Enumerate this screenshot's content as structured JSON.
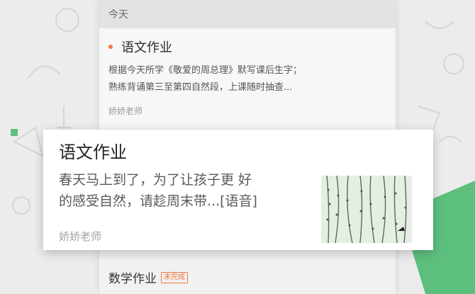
{
  "section": {
    "date_label": "今天"
  },
  "homework_card": {
    "dot_color": "#f07a3a",
    "title": "语文作业",
    "body": "根据今天所学《敬爱的周总理》默写课后生字；\n熟练背诵第三至第四自然段，上课随时抽查...",
    "teacher": "娇娇老师"
  },
  "popup_card": {
    "title": "语文作业",
    "body": "春天马上到了，为了让孩子更 好\n的感受自然，请趁周末带...[语音]",
    "teacher": "娇娇老师",
    "thumbnail_icon": "willow-branches-photo"
  },
  "next_item": {
    "title": "数学作业",
    "status_badge": "未完成",
    "badge_color": "#f0793c"
  },
  "accent_color": "#5dbf7e"
}
